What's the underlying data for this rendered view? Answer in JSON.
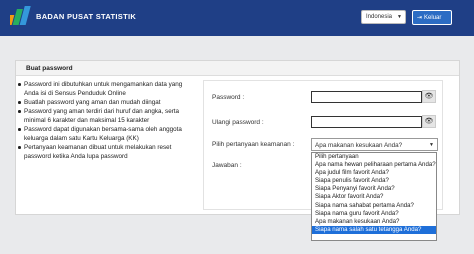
{
  "header": {
    "brand": "BADAN PUSAT STATISTIK",
    "language": "Indonesia",
    "logout_label": "Keluar"
  },
  "panel": {
    "title": "Buat password",
    "info": [
      "Password ini dibutuhkan untuk mengamankan data yang Anda isi di Sensus Penduduk Online",
      "Buatlah password yang aman dan mudah diingat",
      "Password yang aman terdiri dari huruf dan angka, serta minimal 6 karakter dan maksimal 15 karakter",
      "Password dapat digunakan bersama-sama oleh anggota keluarga dalam satu Kartu Keluarga (KK)",
      "Pertanyaan keamanan dibuat untuk melakukan reset password ketika Anda lupa password"
    ]
  },
  "form": {
    "password_label": "Password :",
    "password_value": "",
    "confirm_label": "Ulangi password :",
    "confirm_value": "",
    "question_label": "Pilih pertanyaan keamanan :",
    "question_selected": "Apa makanan kesukaan Anda?",
    "answer_label": "Jawaban :",
    "options": [
      "Pilih pertanyaan",
      "Apa nama hewan peliharaan pertama Anda?",
      "Apa judul film favorit Anda?",
      "Siapa penulis favorit Anda?",
      "Siapa Penyanyi favorit Anda?",
      "Siapa Aktor favorit Anda?",
      "Siapa nama sahabat pertama Anda?",
      "Siapa nama guru favorit Anda?",
      "Apa makanan kesukaan Anda?",
      "Siapa nama salah satu tetangga Anda?"
    ],
    "highlighted_option": "Siapa nama salah satu tetangga Anda?"
  },
  "colors": {
    "header_bg": "#1f3f86",
    "accent": "#2b6cc4",
    "highlight": "#1e6fd9"
  }
}
